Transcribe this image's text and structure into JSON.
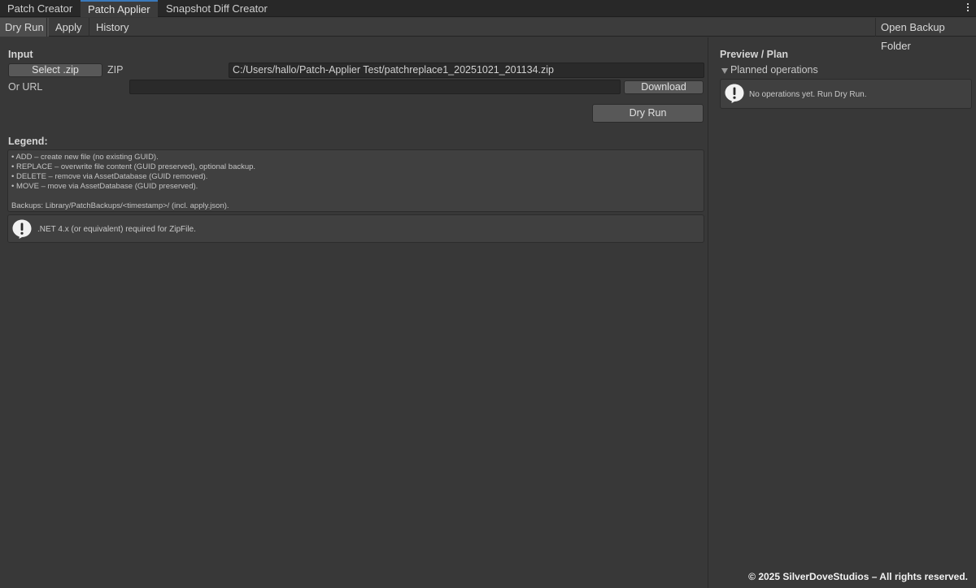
{
  "tabs": [
    {
      "label": "Patch Creator"
    },
    {
      "label": "Patch Applier"
    },
    {
      "label": "Snapshot Diff Creator"
    }
  ],
  "toolbar": {
    "dry_run": "Dry Run",
    "apply": "Apply",
    "history": "History",
    "open_backup": "Open Backup Folder"
  },
  "input": {
    "heading": "Input",
    "select_zip": "Select .zip",
    "zip_label": "ZIP",
    "zip_path": "C:/Users/hallo/Patch-Applier Test/patchreplace1_20251021_201134.zip",
    "url_label": "Or URL",
    "url_value": "",
    "download": "Download",
    "dry_run_button": "Dry Run"
  },
  "legend": {
    "heading": "Legend:",
    "lines": [
      "• ADD – create new file (no existing GUID).",
      "• REPLACE – overwrite file content (GUID preserved), optional backup.",
      "• DELETE – remove via AssetDatabase (GUID removed).",
      "• MOVE – move via AssetDatabase (GUID preserved).",
      "",
      "Backups: Library/PatchBackups/<timestamp>/ (incl. apply.json)."
    ],
    "note": ".NET 4.x (or equivalent) required for ZipFile."
  },
  "preview": {
    "heading": "Preview / Plan",
    "foldout": "Planned operations",
    "empty": "No operations yet. Run Dry Run."
  },
  "footer": "© 2025 SilverDoveStudios – All rights reserved."
}
